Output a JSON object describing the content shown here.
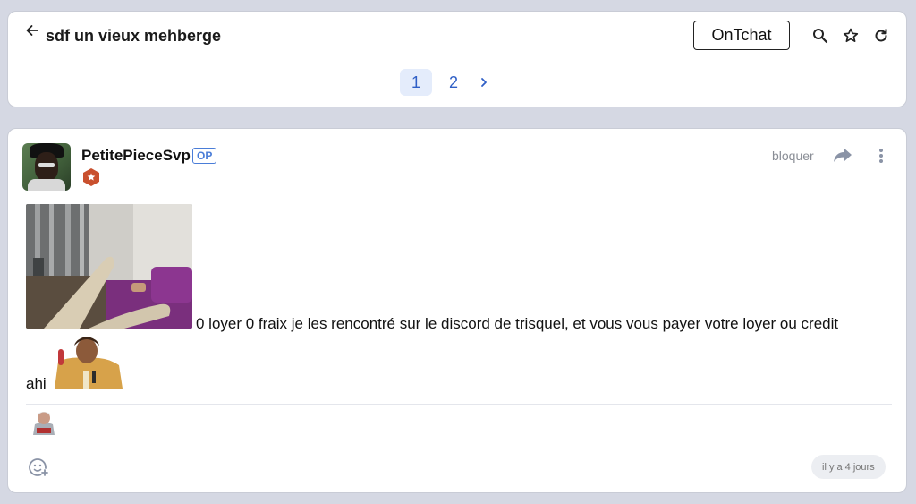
{
  "topic": {
    "title": "sdf un vieux mehberge",
    "ontchat_label": "OnTchat",
    "pages": [
      "1",
      "2"
    ],
    "current_page": "1"
  },
  "post": {
    "author": "PetitePieceSvp",
    "op_label": "OP",
    "block_label": "bloquer",
    "text_line1": "0 loyer 0 fraix je les rencontré sur le discord de trisquel, et vous vous payer votre loyer ou credit",
    "text_line2": "ahi",
    "time": "il y a 4 jours"
  },
  "colors": {
    "accent": "#2f5fc6",
    "page_bg": "#d5d8e3",
    "rank_badge": "#c9502e"
  },
  "icons": {
    "back": "arrow-left-icon",
    "search": "search-icon",
    "favorite": "star-icon",
    "refresh": "refresh-icon",
    "next_page": "chevron-right-icon",
    "share": "share-icon",
    "more": "more-vertical-icon",
    "react": "add-reaction-icon"
  }
}
